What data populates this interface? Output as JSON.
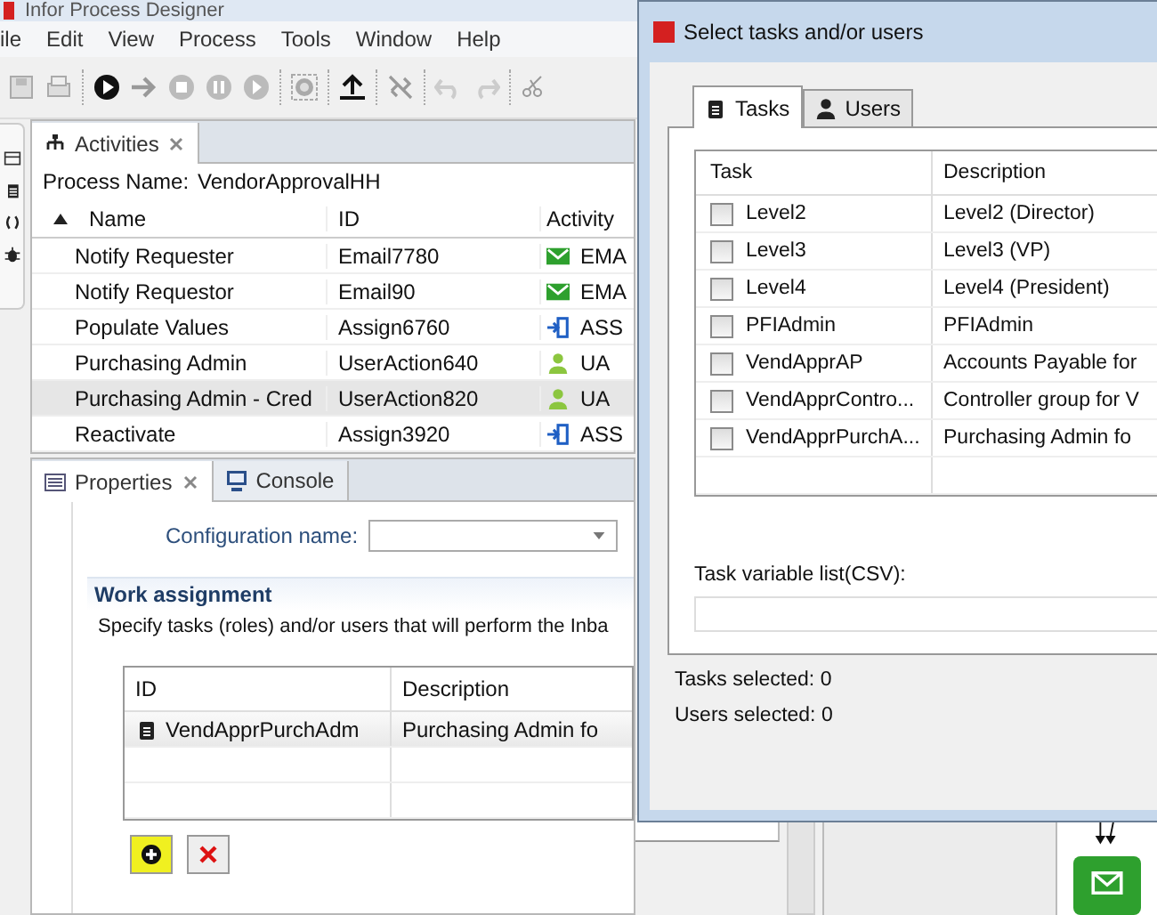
{
  "app": {
    "title": "Infor Process Designer"
  },
  "menu": [
    "ile",
    "Edit",
    "View",
    "Process",
    "Tools",
    "Window",
    "Help"
  ],
  "activities": {
    "tab": "Activities",
    "process_label": "Process Name:",
    "process_name": "VendorApprovalHH",
    "columns": [
      "Name",
      "ID",
      "Activity"
    ],
    "rows": [
      {
        "name": "Notify Requester",
        "id": "Email7780",
        "type": "EMA",
        "kind": "email",
        "selected": false
      },
      {
        "name": "Notify Requestor",
        "id": "Email90",
        "type": "EMA",
        "kind": "email",
        "selected": false
      },
      {
        "name": "Populate Values",
        "id": "Assign6760",
        "type": "ASS",
        "kind": "assign",
        "selected": false
      },
      {
        "name": "Purchasing Admin",
        "id": "UserAction640",
        "type": "UA",
        "kind": "user",
        "selected": false
      },
      {
        "name": "Purchasing Admin - Cred",
        "id": "UserAction820",
        "type": "UA",
        "kind": "user",
        "selected": true
      },
      {
        "name": "Reactivate",
        "id": "Assign3920",
        "type": "ASS",
        "kind": "assign",
        "selected": false
      }
    ]
  },
  "properties": {
    "tabs": [
      {
        "label": "Properties",
        "kind": "properties",
        "selected": true
      },
      {
        "label": "Console",
        "kind": "console",
        "selected": false
      }
    ],
    "config_label": "Configuration name:",
    "section_title": "Work assignment",
    "section_text": "Specify tasks (roles) and/or users that will perform the Inba",
    "table": {
      "columns": [
        "ID",
        "Description"
      ],
      "rows": [
        {
          "id": "VendApprPurchAdm",
          "description": "Purchasing Admin fo"
        }
      ]
    }
  },
  "dialog": {
    "title": "Select tasks and/or users",
    "tabs": [
      {
        "label": "Tasks",
        "kind": "task",
        "selected": true
      },
      {
        "label": "Users",
        "kind": "user",
        "selected": false
      }
    ],
    "columns": [
      "Task",
      "Description"
    ],
    "rows": [
      {
        "task": "Level2",
        "description": "Level2 (Director)",
        "checked": false
      },
      {
        "task": "Level3",
        "description": "Level3 (VP)",
        "checked": false
      },
      {
        "task": "Level4",
        "description": "Level4 (President)",
        "checked": false
      },
      {
        "task": "PFIAdmin",
        "description": "PFIAdmin",
        "checked": false
      },
      {
        "task": "VendApprAP",
        "description": "Accounts Payable for",
        "checked": false
      },
      {
        "task": "VendApprContro...",
        "description": "Controller group for V",
        "checked": false
      },
      {
        "task": "VendApprPurchA...",
        "description": "Purchasing Admin fo",
        "checked": false
      }
    ],
    "variable_label": "Task variable list(CSV):",
    "tasks_selected": "Tasks selected:  0",
    "users_selected": "Users selected:  0"
  }
}
